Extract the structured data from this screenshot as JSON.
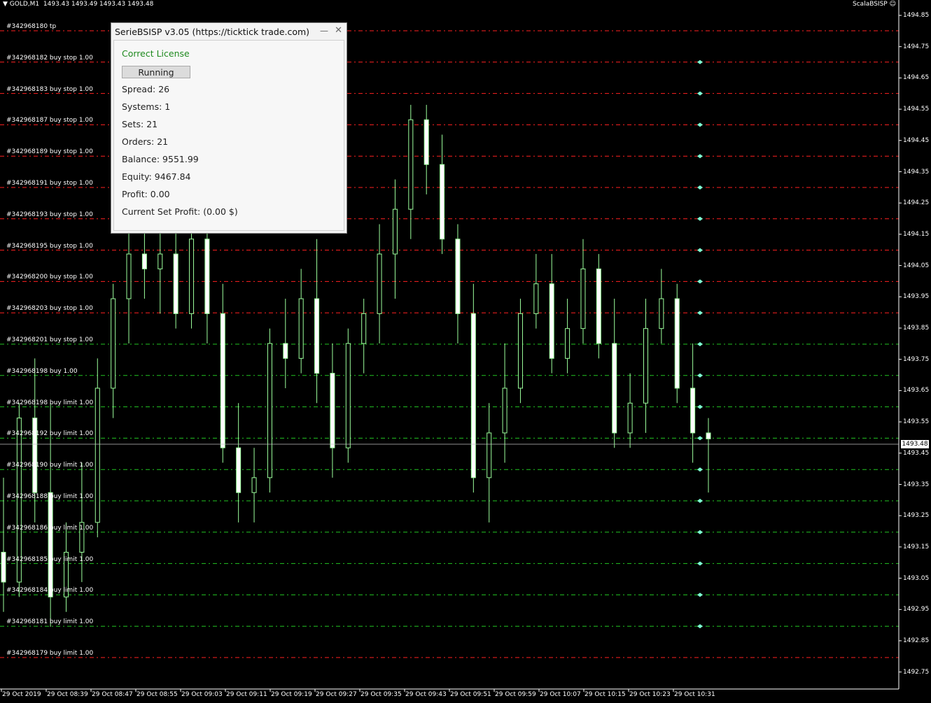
{
  "header": {
    "symbol": "GOLD,M1",
    "ohlc": "1493.43 1493.49 1493.43 1493.48",
    "expert_name": "ScalaBSISP",
    "expert_icon": "smiley-icon"
  },
  "panel": {
    "title": "SerieBSISP v3.05 (https://ticktick trade.com)",
    "license": "Correct License",
    "run_button": "Running",
    "spread": "Spread: 26",
    "systems": "Systems: 1",
    "sets": "Sets: 21",
    "orders": "Orders: 21",
    "balance": "Balance: 9551.99",
    "equity": "Equity: 9467.84",
    "profit": "Profit: 0.00",
    "set_profit": "Current Set Profit: (0.00 $)"
  },
  "price_axis": [
    "1494.85",
    "1494.75",
    "1494.65",
    "1494.55",
    "1494.45",
    "1494.35",
    "1494.25",
    "1494.15",
    "1494.05",
    "1493.95",
    "1493.85",
    "1493.75",
    "1493.65",
    "1493.55",
    "1493.45",
    "1493.35",
    "1493.25",
    "1493.15",
    "1493.05",
    "1492.95",
    "1492.85",
    "1492.75"
  ],
  "current_price": "1493.48",
  "time_axis": [
    "29 Oct 2019",
    "29 Oct 08:39",
    "29 Oct 08:47",
    "29 Oct 08:55",
    "29 Oct 09:03",
    "29 Oct 09:11",
    "29 Oct 09:19",
    "29 Oct 09:27",
    "29 Oct 09:35",
    "29 Oct 09:43",
    "29 Oct 09:51",
    "29 Oct 09:59",
    "29 Oct 10:07",
    "29 Oct 10:15",
    "29 Oct 10:23",
    "29 Oct 10:31"
  ],
  "orders": [
    {
      "label": "#342968180 tp",
      "color": "#ff2020"
    },
    {
      "label": "#342968182 buy stop 1.00",
      "color": "#ff2020"
    },
    {
      "label": "#342968183 buy stop 1.00",
      "color": "#ff2020"
    },
    {
      "label": "#342968187 buy stop 1.00",
      "color": "#ff2020"
    },
    {
      "label": "#342968189 buy stop 1.00",
      "color": "#ff2020"
    },
    {
      "label": "#342968191 buy stop 1.00",
      "color": "#ff2020"
    },
    {
      "label": "#342968193 buy stop 1.00",
      "color": "#ff2020"
    },
    {
      "label": "#342968195 buy stop 1.00",
      "color": "#ff2020"
    },
    {
      "label": "#342968200 buy stop 1.00",
      "color": "#ff2020"
    },
    {
      "label": "#342968203 buy stop 1.00",
      "color": "#ff2020"
    },
    {
      "label": "#342968201 buy stop 1.00",
      "color": "#22c422"
    },
    {
      "label": "#342968198 buy 1.00",
      "color": "#22c422"
    },
    {
      "label": "#342968198 buy limit 1.00",
      "color": "#22c422"
    },
    {
      "label": "#342968192 buy limit 1.00",
      "color": "#22c422"
    },
    {
      "label": "#342968190 buy limit 1.00",
      "color": "#22c422"
    },
    {
      "label": "#342968188 buy limit 1.00",
      "color": "#22c422"
    },
    {
      "label": "#342968186 buy limit 1.00",
      "color": "#22c422"
    },
    {
      "label": "#342968185 buy limit 1.00",
      "color": "#22c422"
    },
    {
      "label": "#342968184 buy limit 1.00",
      "color": "#22c422"
    },
    {
      "label": "#342968181 buy limit 1.00",
      "color": "#22c422"
    },
    {
      "label": "#342968179 buy limit 1.00",
      "color": "#ff2020"
    }
  ],
  "colors": {
    "candle": "#9cff9c",
    "bull_body": "#000000",
    "bear_body": "#ffffff",
    "stop_line": "#ff2020",
    "limit_line": "#22c422",
    "grid": "#1a1a1a"
  },
  "chart_data": {
    "type": "candlestick",
    "y_range": [
      1492.7,
      1494.9
    ],
    "candles": [
      [
        1493.1,
        1493.35,
        1492.9,
        1493.0
      ],
      [
        1493.0,
        1493.6,
        1492.95,
        1493.55
      ],
      [
        1493.55,
        1493.75,
        1493.2,
        1493.3
      ],
      [
        1493.3,
        1493.6,
        1492.85,
        1492.95
      ],
      [
        1492.95,
        1493.2,
        1492.9,
        1493.1
      ],
      [
        1493.1,
        1493.4,
        1493.0,
        1493.2
      ],
      [
        1493.2,
        1493.75,
        1493.15,
        1493.65
      ],
      [
        1493.65,
        1494.0,
        1493.55,
        1493.95
      ],
      [
        1493.95,
        1494.2,
        1493.8,
        1494.1
      ],
      [
        1494.1,
        1494.3,
        1493.95,
        1494.05
      ],
      [
        1494.05,
        1494.2,
        1493.9,
        1494.1
      ],
      [
        1494.1,
        1494.25,
        1493.85,
        1493.9
      ],
      [
        1493.9,
        1494.2,
        1493.85,
        1494.15
      ],
      [
        1494.15,
        1494.25,
        1493.8,
        1493.9
      ],
      [
        1493.9,
        1494.0,
        1493.4,
        1493.45
      ],
      [
        1493.45,
        1493.6,
        1493.2,
        1493.3
      ],
      [
        1493.3,
        1493.45,
        1493.2,
        1493.35
      ],
      [
        1493.35,
        1493.85,
        1493.3,
        1493.8
      ],
      [
        1493.8,
        1493.95,
        1493.65,
        1493.75
      ],
      [
        1493.75,
        1494.05,
        1493.7,
        1493.95
      ],
      [
        1493.95,
        1494.15,
        1493.6,
        1493.7
      ],
      [
        1493.7,
        1493.8,
        1493.35,
        1493.45
      ],
      [
        1493.45,
        1493.85,
        1493.4,
        1493.8
      ],
      [
        1493.8,
        1493.95,
        1493.7,
        1493.9
      ],
      [
        1493.9,
        1494.2,
        1493.8,
        1494.1
      ],
      [
        1494.1,
        1494.35,
        1493.95,
        1494.25
      ],
      [
        1494.25,
        1494.6,
        1494.15,
        1494.55
      ],
      [
        1494.55,
        1494.6,
        1494.3,
        1494.4
      ],
      [
        1494.4,
        1494.5,
        1494.1,
        1494.15
      ],
      [
        1494.15,
        1494.2,
        1493.8,
        1493.9
      ],
      [
        1493.9,
        1494.0,
        1493.3,
        1493.35
      ],
      [
        1493.35,
        1493.6,
        1493.2,
        1493.5
      ],
      [
        1493.5,
        1493.8,
        1493.4,
        1493.65
      ],
      [
        1493.65,
        1493.95,
        1493.6,
        1493.9
      ],
      [
        1493.9,
        1494.1,
        1493.85,
        1494.0
      ],
      [
        1494.0,
        1494.1,
        1493.7,
        1493.75
      ],
      [
        1493.75,
        1493.95,
        1493.7,
        1493.85
      ],
      [
        1493.85,
        1494.15,
        1493.8,
        1494.05
      ],
      [
        1494.05,
        1494.1,
        1493.75,
        1493.8
      ],
      [
        1493.8,
        1493.95,
        1493.45,
        1493.5
      ],
      [
        1493.5,
        1493.7,
        1493.45,
        1493.6
      ],
      [
        1493.6,
        1493.95,
        1493.5,
        1493.85
      ],
      [
        1493.85,
        1494.05,
        1493.8,
        1493.95
      ],
      [
        1493.95,
        1494.0,
        1493.6,
        1493.65
      ],
      [
        1493.65,
        1493.8,
        1493.4,
        1493.5
      ],
      [
        1493.5,
        1493.55,
        1493.3,
        1493.48
      ]
    ]
  }
}
